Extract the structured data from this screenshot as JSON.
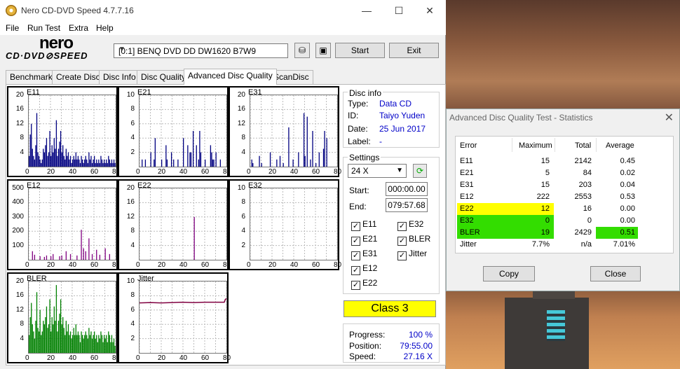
{
  "window": {
    "title": "Nero CD-DVD Speed 4.7.7.16",
    "minimize": "—",
    "maximize": "☐",
    "close": "✕"
  },
  "menu": [
    "File",
    "Run Test",
    "Extra",
    "Help"
  ],
  "logo": {
    "top": "nero",
    "bottom": "CD·DVD⊘SPEED"
  },
  "drive": "[0:1]   BENQ DVD DD DW1620 B7W9",
  "toolbar": {
    "start": "Start",
    "exit": "Exit"
  },
  "tabs": [
    "Benchmark",
    "Create Disc",
    "Disc Info",
    "Disc Quality",
    "Advanced Disc Quality",
    "ScanDisc"
  ],
  "active_tab": "Advanced Disc Quality",
  "disc_info": {
    "caption": "Disc info",
    "type_label": "Type:",
    "type": "Data CD",
    "id_label": "ID:",
    "id": "Taiyo Yuden",
    "date_label": "Date:",
    "date": "25 Jun 2017",
    "label_label": "Label:",
    "label": "-"
  },
  "settings": {
    "caption": "Settings",
    "speed": "24 X",
    "start_label": "Start:",
    "start": "000:00.00",
    "end_label": "End:",
    "end": "079:57.68",
    "checks": [
      {
        "label": "E11",
        "checked": true
      },
      {
        "label": "E32",
        "checked": true
      },
      {
        "label": "E21",
        "checked": true
      },
      {
        "label": "BLER",
        "checked": true
      },
      {
        "label": "E31",
        "checked": true
      },
      {
        "label": "Jitter",
        "checked": true
      },
      {
        "label": "E12",
        "checked": true
      },
      {
        "label": "E22",
        "checked": true
      }
    ]
  },
  "class_label": "Class 3",
  "progress": {
    "progress_label": "Progress:",
    "progress": "100 %",
    "position_label": "Position:",
    "position": "79:55.00",
    "speed_label": "Speed:",
    "speed": "27.16 X"
  },
  "colors": {
    "e_series": "#000080",
    "e22": "#800080",
    "bler": "#008000",
    "jitter": "#800040",
    "class_bg": "#ffff00",
    "hl_yellow": "#ffff00",
    "hl_green": "#33dd00"
  },
  "chart_data": [
    {
      "type": "bar",
      "title": "E11",
      "ylim": [
        0,
        20
      ],
      "yticks": [
        4,
        8,
        12,
        16,
        20
      ],
      "xticks": [
        0,
        20,
        40,
        60,
        80
      ],
      "color": "#000080",
      "x": [
        0,
        1,
        2,
        3,
        4,
        5,
        6,
        7,
        8,
        9,
        10,
        11,
        12,
        13,
        14,
        15,
        16,
        17,
        18,
        19,
        20,
        21,
        22,
        23,
        24,
        25,
        26,
        27,
        28,
        29,
        30,
        31,
        32,
        33,
        34,
        35,
        36,
        37,
        38,
        39,
        40,
        41,
        42,
        43,
        44,
        45,
        46,
        47,
        48,
        49,
        50,
        51,
        52,
        53,
        54,
        55,
        56,
        57,
        58,
        59,
        60,
        61,
        62,
        63,
        64,
        65,
        66,
        67,
        68,
        69,
        70,
        71,
        72,
        73,
        74,
        75,
        76,
        77,
        78,
        79
      ],
      "values": [
        3,
        9,
        12,
        5,
        3,
        2,
        6,
        15,
        4,
        3,
        2,
        1,
        2,
        5,
        4,
        6,
        8,
        3,
        4,
        10,
        3,
        6,
        4,
        8,
        5,
        13,
        3,
        5,
        7,
        10,
        4,
        6,
        3,
        2,
        5,
        3,
        4,
        2,
        3,
        1,
        2,
        3,
        2,
        4,
        2,
        3,
        2,
        1,
        3,
        2,
        1,
        2,
        3,
        2,
        1,
        4,
        2,
        3,
        1,
        2,
        3,
        1,
        2,
        1,
        2,
        1,
        3,
        2,
        1,
        2,
        1,
        2,
        1,
        3,
        2,
        1,
        2,
        1,
        2,
        1
      ]
    },
    {
      "type": "bar",
      "title": "E21",
      "ylim": [
        0,
        10
      ],
      "yticks": [
        2,
        4,
        6,
        8,
        10
      ],
      "xticks": [
        0,
        20,
        40,
        60,
        80
      ],
      "color": "#000080",
      "x": [
        2,
        5,
        10,
        13,
        14,
        20,
        24,
        25,
        29,
        31,
        35,
        40,
        44,
        46,
        47,
        49,
        52,
        54,
        55,
        56,
        60,
        65,
        66,
        67,
        68,
        70,
        74
      ],
      "values": [
        1,
        1,
        2,
        1,
        4,
        1,
        3,
        1,
        2,
        1,
        1,
        4,
        3,
        2,
        2,
        5,
        3,
        1,
        5,
        2,
        1,
        3,
        2,
        1,
        1,
        2,
        1
      ]
    },
    {
      "type": "bar",
      "title": "E31",
      "ylim": [
        0,
        20
      ],
      "yticks": [
        4,
        8,
        12,
        16,
        20
      ],
      "xticks": [
        0,
        20,
        40,
        60,
        80
      ],
      "color": "#000080",
      "x": [
        1,
        2,
        8,
        10,
        18,
        24,
        27,
        30,
        35,
        39,
        44,
        49,
        50,
        52,
        55,
        57,
        60,
        63,
        67,
        68,
        70
      ],
      "values": [
        2,
        1,
        3,
        1,
        4,
        2,
        3,
        1,
        11,
        2,
        4,
        15,
        3,
        14,
        2,
        10,
        1,
        4,
        5,
        10,
        8
      ]
    },
    {
      "type": "bar",
      "title": "E12",
      "ylim": [
        0,
        500
      ],
      "yticks": [
        100,
        200,
        300,
        400,
        500
      ],
      "xticks": [
        0,
        20,
        40,
        60,
        80
      ],
      "color": "#800080",
      "x": [
        3,
        5,
        10,
        14,
        16,
        20,
        22,
        28,
        30,
        34,
        38,
        44,
        48,
        50,
        52,
        55,
        58,
        62,
        65,
        70,
        74
      ],
      "values": [
        60,
        35,
        25,
        20,
        30,
        25,
        40,
        25,
        30,
        60,
        40,
        30,
        210,
        80,
        60,
        150,
        40,
        70,
        35,
        80,
        40
      ]
    },
    {
      "type": "bar",
      "title": "E22",
      "ylim": [
        0,
        20
      ],
      "yticks": [
        4,
        8,
        12,
        16,
        20
      ],
      "xticks": [
        0,
        20,
        40,
        60,
        80
      ],
      "color": "#800080",
      "x": [
        50
      ],
      "values": [
        12
      ]
    },
    {
      "type": "bar",
      "title": "E32",
      "ylim": [
        0,
        10
      ],
      "yticks": [
        2,
        4,
        6,
        8,
        10
      ],
      "xticks": [
        0,
        20,
        40,
        60,
        80
      ],
      "color": "#800080",
      "x": [],
      "values": []
    },
    {
      "type": "bar",
      "title": "BLER",
      "ylim": [
        0,
        20
      ],
      "yticks": [
        4,
        8,
        12,
        16,
        20
      ],
      "xticks": [
        0,
        20,
        40,
        60,
        80
      ],
      "color": "#008000",
      "x": [
        0,
        1,
        2,
        3,
        4,
        5,
        6,
        7,
        8,
        9,
        10,
        11,
        12,
        13,
        14,
        15,
        16,
        17,
        18,
        19,
        20,
        21,
        22,
        23,
        24,
        25,
        26,
        27,
        28,
        29,
        30,
        31,
        32,
        33,
        34,
        35,
        36,
        37,
        38,
        39,
        40,
        41,
        42,
        43,
        44,
        45,
        46,
        47,
        48,
        49,
        50,
        51,
        52,
        53,
        54,
        55,
        56,
        57,
        58,
        59,
        60,
        61,
        62,
        63,
        64,
        65,
        66,
        67,
        68,
        69,
        70,
        71,
        72,
        73,
        74,
        75,
        76,
        77,
        78,
        79
      ],
      "values": [
        5,
        10,
        14,
        8,
        6,
        4,
        9,
        17,
        7,
        6,
        12,
        5,
        6,
        9,
        8,
        10,
        13,
        7,
        8,
        15,
        6,
        10,
        8,
        13,
        9,
        19,
        6,
        9,
        11,
        15,
        8,
        10,
        7,
        5,
        9,
        6,
        8,
        5,
        6,
        4,
        5,
        7,
        5,
        8,
        5,
        6,
        5,
        3,
        6,
        5,
        4,
        5,
        6,
        5,
        4,
        7,
        5,
        6,
        4,
        5,
        6,
        4,
        5,
        3,
        5,
        4,
        6,
        5,
        3,
        5,
        4,
        5,
        3,
        6,
        5,
        3,
        5,
        3,
        4,
        2
      ]
    },
    {
      "type": "line",
      "title": "Jitter",
      "ylim": [
        0,
        10
      ],
      "yticks": [
        2,
        4,
        6,
        8,
        10
      ],
      "xticks": [
        0,
        20,
        40,
        60,
        80
      ],
      "color": "#800040",
      "x": [
        0,
        10,
        20,
        30,
        40,
        50,
        60,
        70,
        78,
        79,
        80
      ],
      "values": [
        7.0,
        7.05,
        7.0,
        7.05,
        7.1,
        7.05,
        7.1,
        7.1,
        7.1,
        7.5,
        7.6
      ]
    }
  ],
  "stats": {
    "title": "Advanced Disc Quality Test - Statistics",
    "close": "✕",
    "headers": [
      "Error",
      "Maximum",
      "Total",
      "Average"
    ],
    "rows": [
      {
        "name": "E11",
        "max": "15",
        "total": "2142",
        "avg": "0.45",
        "hl_max": "",
        "hl_avg": ""
      },
      {
        "name": "E21",
        "max": "5",
        "total": "84",
        "avg": "0.02",
        "hl_max": "",
        "hl_avg": ""
      },
      {
        "name": "E31",
        "max": "15",
        "total": "203",
        "avg": "0.04",
        "hl_max": "",
        "hl_avg": ""
      },
      {
        "name": "E12",
        "max": "222",
        "total": "2553",
        "avg": "0.53",
        "hl_max": "",
        "hl_avg": ""
      },
      {
        "name": "E22",
        "max": "12",
        "total": "16",
        "avg": "0.00",
        "hl_max": "yellow",
        "hl_avg": ""
      },
      {
        "name": "E32",
        "max": "0",
        "total": "0",
        "avg": "0.00",
        "hl_max": "green",
        "hl_avg": ""
      },
      {
        "name": "BLER",
        "max": "19",
        "total": "2429",
        "avg": "0.51",
        "hl_max": "green",
        "hl_avg": "green"
      },
      {
        "name": "Jitter",
        "max": "7.7%",
        "total": "n/a",
        "avg": "7.01%",
        "hl_max": "",
        "hl_avg": ""
      }
    ],
    "copy": "Copy",
    "close_btn": "Close"
  }
}
